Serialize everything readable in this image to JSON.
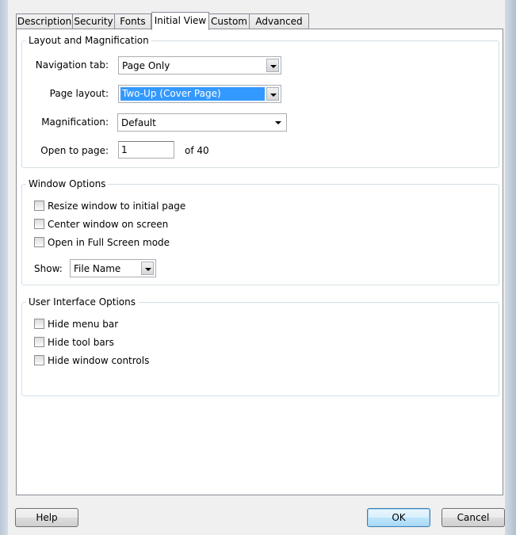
{
  "tabs": [
    "Description",
    "Security",
    "Fonts",
    "Initial View",
    "Custom",
    "Advanced"
  ],
  "layout_group": {
    "title": "Layout and Magnification",
    "navigation_tab": {
      "label": "Navigation tab:",
      "value": "Page Only"
    },
    "page_layout": {
      "label": "Page layout:",
      "value": "Two-Up (Cover Page)"
    },
    "magnification": {
      "label": "Magnification:",
      "value": "Default"
    },
    "open_to_page": {
      "label": "Open to page:",
      "value": "1",
      "of_label": "of 40"
    }
  },
  "window_group": {
    "title": "Window Options",
    "checks": [
      {
        "label": "Resize window to initial page",
        "checked": false
      },
      {
        "label": "Center window on screen",
        "checked": false
      },
      {
        "label": "Open in Full Screen mode",
        "checked": false
      }
    ],
    "show": {
      "label": "Show:",
      "value": "File Name"
    }
  },
  "ui_group": {
    "title": "User Interface Options",
    "checks": [
      {
        "label": "Hide menu bar",
        "checked": false
      },
      {
        "label": "Hide tool bars",
        "checked": false
      },
      {
        "label": "Hide window controls",
        "checked": false
      }
    ]
  },
  "buttons": {
    "help": "Help",
    "ok": "OK",
    "cancel": "Cancel"
  },
  "colors": {
    "selection": "#3399ff",
    "panel": "#ffffff",
    "dialog": "#f0f0f0"
  }
}
